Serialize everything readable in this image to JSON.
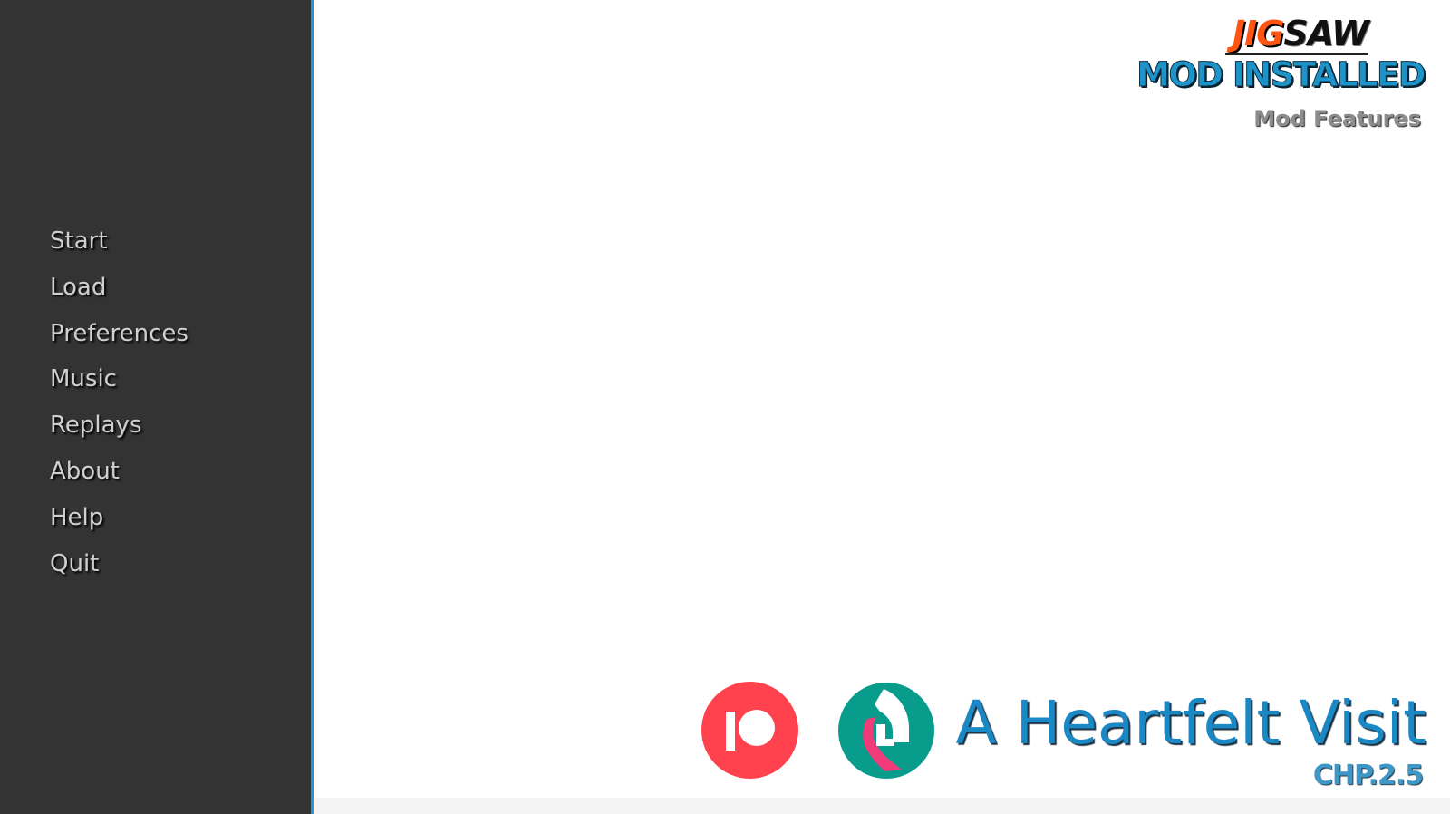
{
  "menu": {
    "items": [
      {
        "label": "Start"
      },
      {
        "label": "Load"
      },
      {
        "label": "Preferences"
      },
      {
        "label": "Music"
      },
      {
        "label": "Replays"
      },
      {
        "label": "About"
      },
      {
        "label": "Help"
      },
      {
        "label": "Quit"
      }
    ]
  },
  "mod_badge": {
    "brand_part1": "JIG",
    "brand_part2": "SAW",
    "status": "MOD INSTALLED",
    "features_link": "Mod Features"
  },
  "links": {
    "patreon_icon": "patreon-icon",
    "subscribestar_icon": "subscribestar-icon"
  },
  "game": {
    "title": "A Heartfelt Visit",
    "version": "CHP.2.5"
  },
  "colors": {
    "sidebar_bg": "#333333",
    "sidebar_border": "#1a9ad6",
    "title_blue": "#1a88c4",
    "jig_orange": "#ff5412",
    "patreon_red": "#ff424d",
    "subscribestar_teal": "#089c8c"
  }
}
